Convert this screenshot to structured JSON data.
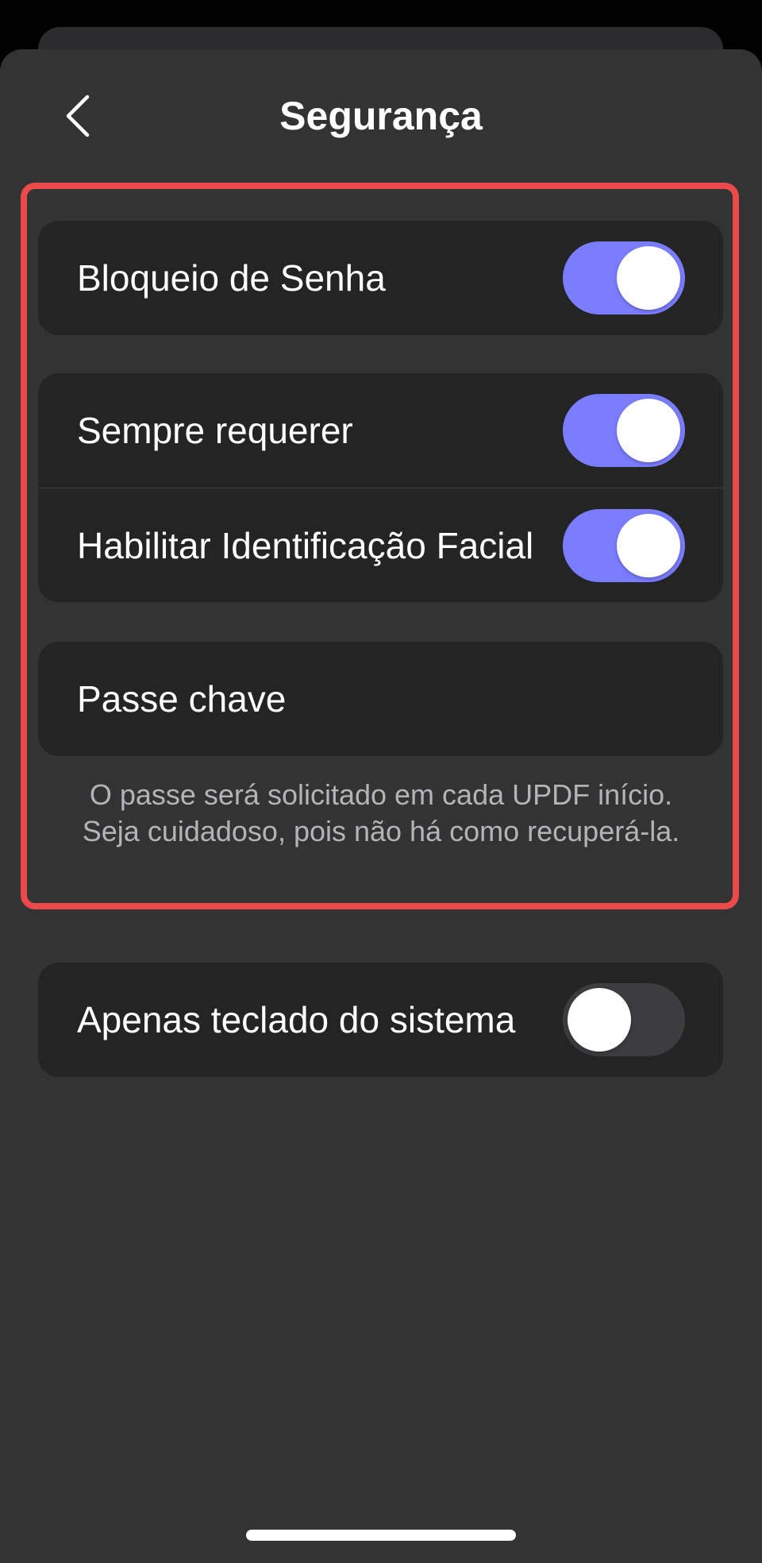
{
  "header": {
    "title": "Segurança",
    "back_icon": "chevron-left-icon"
  },
  "security": {
    "password_lock": {
      "label": "Bloqueio de Senha",
      "enabled": true
    },
    "always_require": {
      "label": "Sempre requerer",
      "enabled": true
    },
    "face_id": {
      "label": "Habilitar Identificação Facial",
      "enabled": true
    },
    "passkey": {
      "label": "Passe chave"
    },
    "footnote": "O passe será solicitado em cada UPDF início. Seja cuidadoso, pois não há como recuperá-la."
  },
  "keyboard": {
    "system_keyboard_only": {
      "label": "Apenas teclado do sistema",
      "enabled": false
    }
  },
  "colors": {
    "accent": "#7a7dff",
    "highlight_border": "#ec4a4a",
    "background": "#333333",
    "card": "#242424"
  }
}
